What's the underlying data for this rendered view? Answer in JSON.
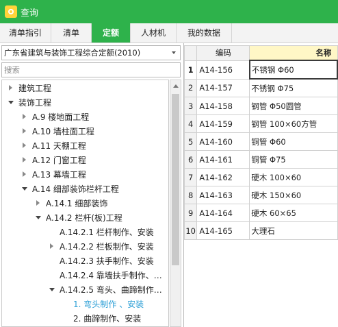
{
  "window": {
    "title": "查询"
  },
  "tabs": [
    "清单指引",
    "清单",
    "定额",
    "人材机",
    "我的数据"
  ],
  "left": {
    "quota_select": "广东省建筑与装饰工程综合定额(2010)",
    "search_placeholder": "搜索",
    "tree": [
      {
        "label": "建筑工程"
      },
      {
        "label": "装饰工程"
      },
      {
        "label": "A.9 楼地面工程"
      },
      {
        "label": "A.10 墙柱面工程"
      },
      {
        "label": "A.11 天棚工程"
      },
      {
        "label": "A.12 门窗工程"
      },
      {
        "label": "A.13 幕墙工程"
      },
      {
        "label": "A.14 细部装饰栏杆工程"
      },
      {
        "label": "A.14.1 细部装饰"
      },
      {
        "label": "A.14.2 栏杆(板)工程"
      },
      {
        "label": "A.14.2.1 栏杆制作、安装"
      },
      {
        "label": "A.14.2.2 栏板制作、安装"
      },
      {
        "label": "A.14.2.3 扶手制作、安装"
      },
      {
        "label": "A.14.2.4 靠墙扶手制作、…"
      },
      {
        "label": "A.14.2.5 弯头、曲蹄制作…"
      },
      {
        "label": "1. 弯头制作 、安装"
      },
      {
        "label": "2. 曲蹄制作、安装"
      }
    ]
  },
  "table": {
    "headers": {
      "code": "编码",
      "name": "名称"
    },
    "rows": [
      {
        "idx": "1",
        "code": "A14-156",
        "name": "不锈钢 Φ60"
      },
      {
        "idx": "2",
        "code": "A14-157",
        "name": "不锈钢 Φ75"
      },
      {
        "idx": "3",
        "code": "A14-158",
        "name": "钢管 Φ50圆管"
      },
      {
        "idx": "4",
        "code": "A14-159",
        "name": "钢管 100×60方管"
      },
      {
        "idx": "5",
        "code": "A14-160",
        "name": "铜管 Φ60"
      },
      {
        "idx": "6",
        "code": "A14-161",
        "name": "铜管 Φ75"
      },
      {
        "idx": "7",
        "code": "A14-162",
        "name": "硬木 100×60"
      },
      {
        "idx": "8",
        "code": "A14-163",
        "name": "硬木 150×60"
      },
      {
        "idx": "9",
        "code": "A14-164",
        "name": "硬木 60×65"
      },
      {
        "idx": "10",
        "code": "A14-165",
        "name": "大理石"
      }
    ]
  },
  "colors": {
    "accent": "#2eb24b",
    "selected_text": "#2d9fd6",
    "header_highlight": "#fff7c6"
  },
  "icons": {
    "app": "search-app-icon",
    "expanded": "triangle-down-icon",
    "collapsed": "triangle-right-icon"
  }
}
